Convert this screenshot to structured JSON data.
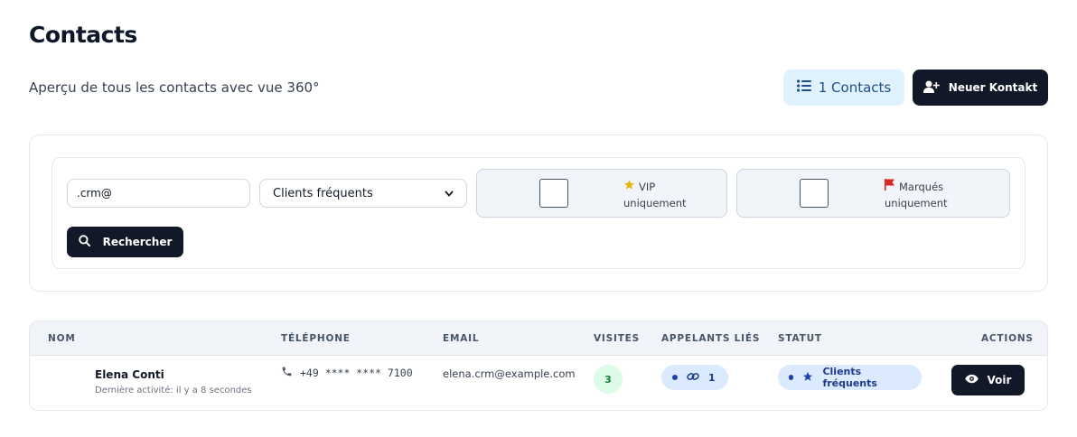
{
  "header": {
    "title": "Contacts",
    "subtitle": "Aperçu de tous les contacts avec vue 360°",
    "count_label": "1 Contacts",
    "new_contact_label": "Neuer Kontakt"
  },
  "filters": {
    "search_value": ".crm@",
    "segment_selected": "Clients fréquents",
    "vip_toggle": {
      "line1": "VIP",
      "line2": "uniquement"
    },
    "flagged_toggle": {
      "line1": "Marqués",
      "line2": "uniquement"
    },
    "search_button": "Rechercher"
  },
  "table": {
    "columns": {
      "name": "NOM",
      "phone": "TÉLÉPHONE",
      "email": "EMAIL",
      "visits": "VISITES",
      "linked": "APPELANTS LIÉS",
      "status": "STATUT",
      "actions": "ACTIONS"
    },
    "rows": [
      {
        "name": "Elena Conti",
        "activity": "Dernière activité: il y a 8 secondes",
        "phone": "+49 **** **** 7100",
        "email": "elena.crm@example.com",
        "visits": "3",
        "linked": "1",
        "status": "Clients fréquents",
        "action": "Voir"
      }
    ]
  },
  "colors": {
    "primary_dark": "#111827",
    "accent_light_blue": "#e0f2fe",
    "badge_green": "#dcfce7",
    "pill_blue": "#dbeafe",
    "vip_star": "#eab308",
    "flag_red": "#dc2626"
  },
  "icons": {
    "count": "list-icon",
    "new_contact": "user-plus-icon",
    "search": "search-icon",
    "vip": "star-icon",
    "flagged": "flag-icon",
    "phone": "phone-icon",
    "link": "link-icon",
    "status": "star-icon",
    "view": "eye-icon"
  }
}
